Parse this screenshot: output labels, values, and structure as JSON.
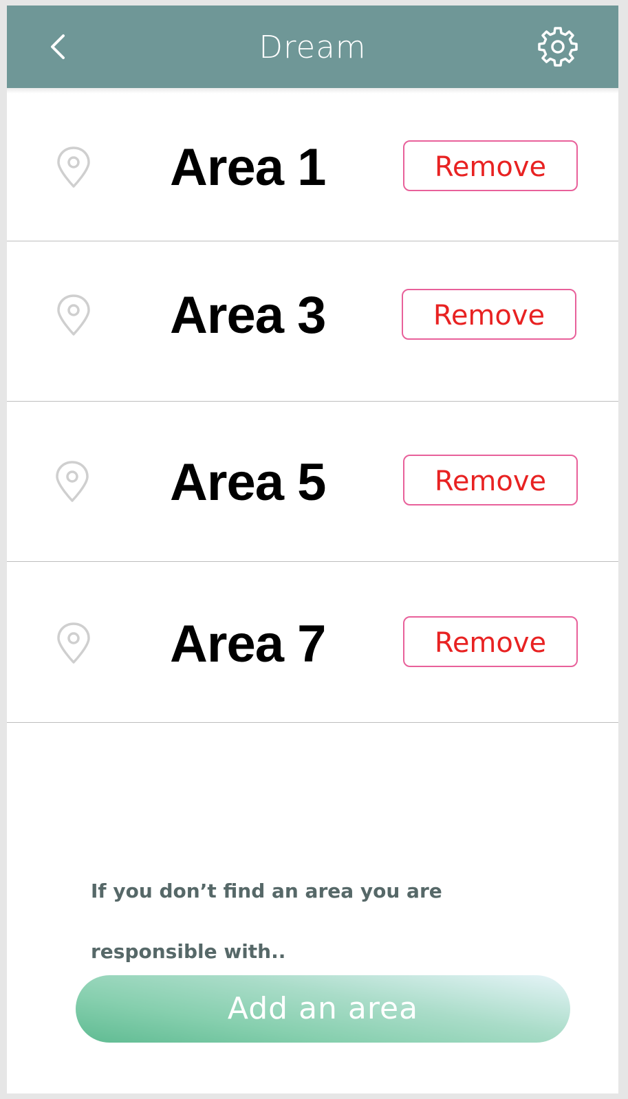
{
  "status_bar": {
    "fragment": "·····"
  },
  "header": {
    "title": "Dream",
    "back_icon": "chevron-left-icon",
    "settings_icon": "gear-icon"
  },
  "areas": [
    {
      "label": "Area 1",
      "icon": "location-pin-icon",
      "remove_label": "Remove"
    },
    {
      "label": "Area 3",
      "icon": "location-pin-icon",
      "remove_label": "Remove"
    },
    {
      "label": "Area 5",
      "icon": "location-pin-icon",
      "remove_label": "Remove"
    },
    {
      "label": "Area 7",
      "icon": "location-pin-icon",
      "remove_label": "Remove"
    }
  ],
  "hint": {
    "text": "If you don’t find an area you are responsible with.."
  },
  "add_button": {
    "label": "Add an area"
  },
  "colors": {
    "header_bg": "#6f9797",
    "remove_border": "#e8609a",
    "remove_text": "#e82222",
    "hint_text": "#566868",
    "add_gradient_start": "#e6f4f8",
    "add_gradient_end": "#5fbb92"
  }
}
